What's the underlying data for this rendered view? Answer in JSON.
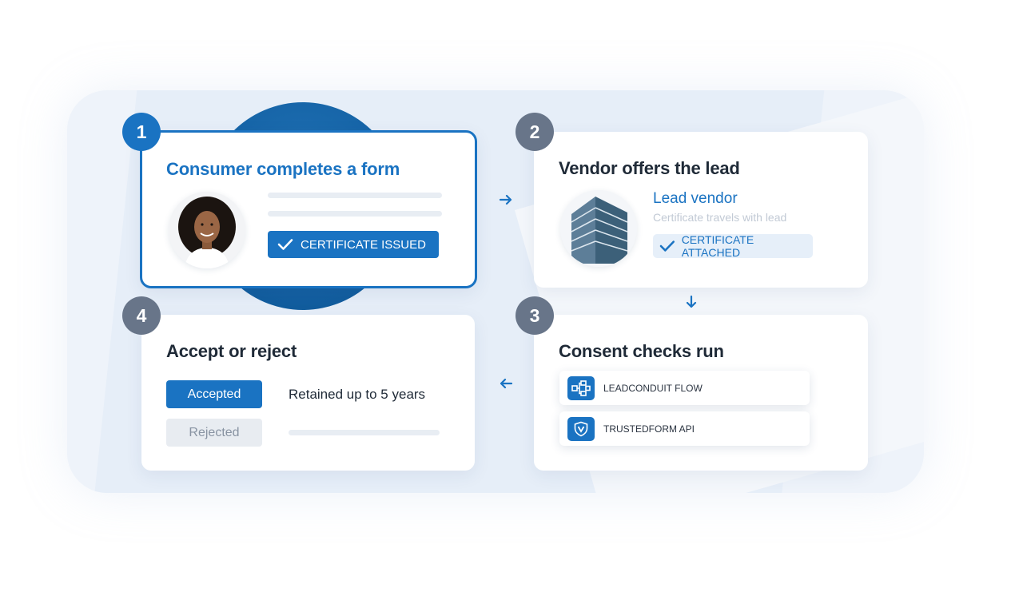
{
  "steps": [
    {
      "number": "1",
      "title": "Consumer completes a form",
      "button": "CERTIFICATE ISSUED"
    },
    {
      "number": "2",
      "title": "Vendor offers the lead",
      "vendor_name": "Lead vendor",
      "vendor_subtitle": "Certificate travels with lead",
      "chip": "CERTIFICATE ATTACHED"
    },
    {
      "number": "3",
      "title": "Consent checks run",
      "tools": [
        {
          "label": "LEADCONDUIT FLOW",
          "icon": "flow-icon"
        },
        {
          "label": "TRUSTEDFORM API",
          "icon": "shield-v-icon"
        }
      ]
    },
    {
      "number": "4",
      "title": "Accept or reject",
      "accepted": "Accepted",
      "rejected": "Rejected",
      "retained": "Retained up to 5 years"
    }
  ],
  "colors": {
    "primary": "#1a73c2",
    "badge_gray": "#687589",
    "text": "#1f2a37"
  }
}
